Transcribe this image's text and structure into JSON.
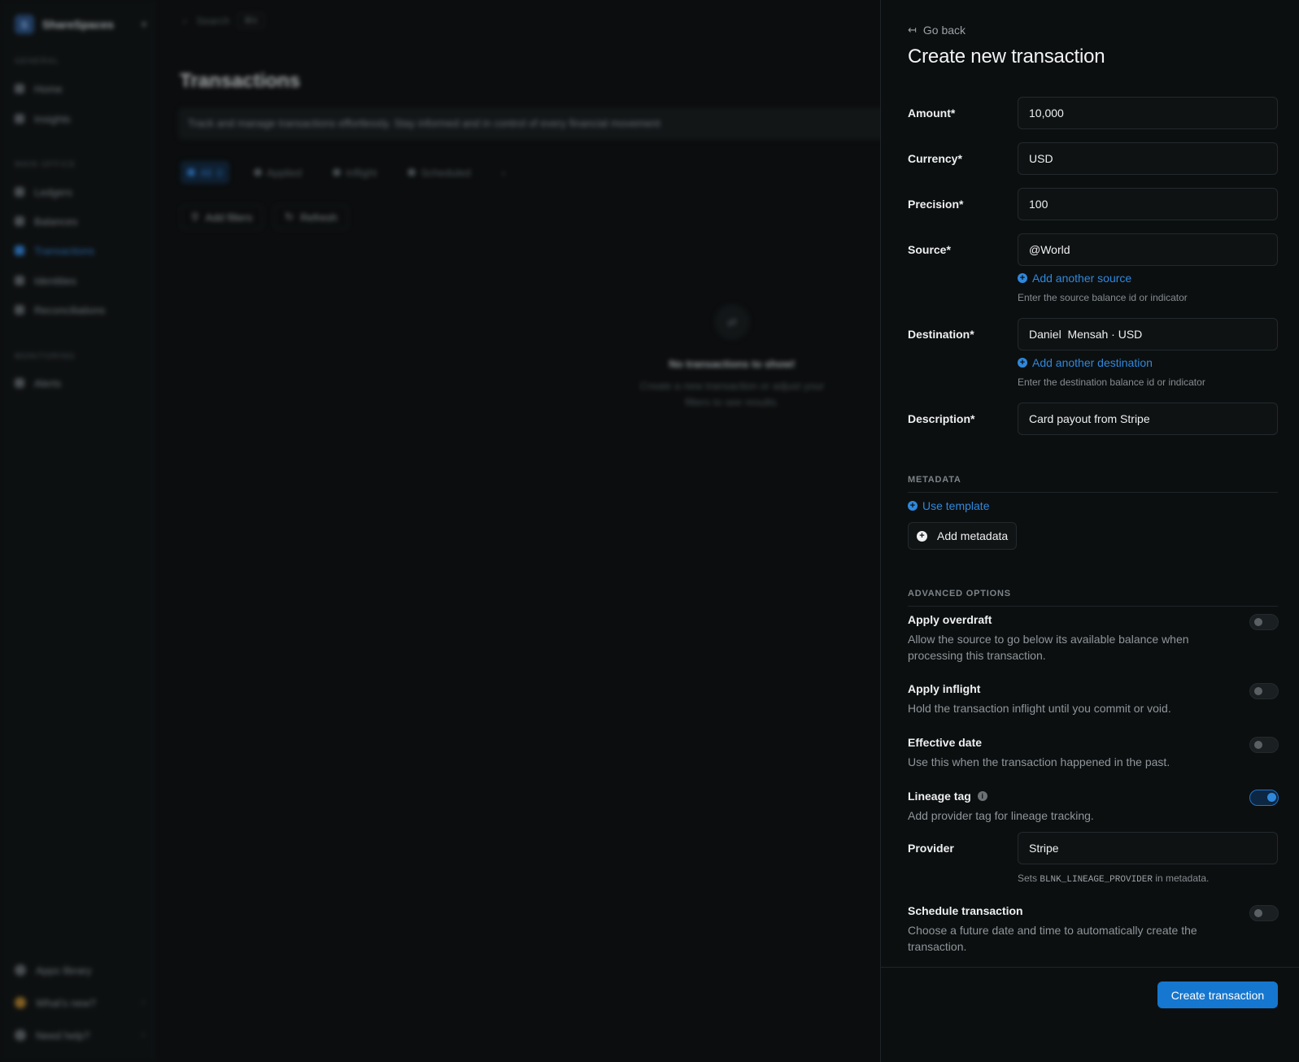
{
  "background": {
    "workspace": {
      "initial": "S",
      "name": "ShareSpaces"
    },
    "sections": [
      "GENERAL",
      "MAIN OFFICE",
      "MONITORING"
    ],
    "nav": [
      {
        "label": "Home"
      },
      {
        "label": "Insights"
      },
      {
        "label": "Ledgers"
      },
      {
        "label": "Balances"
      },
      {
        "label": "Transactions"
      },
      {
        "label": "Identities"
      },
      {
        "label": "Reconciliations"
      },
      {
        "label": "Alerts"
      }
    ],
    "bottom": [
      {
        "label": "Apps library"
      },
      {
        "label": "What's new?"
      },
      {
        "label": "Need help?"
      }
    ],
    "search": {
      "placeholder": "Search",
      "shortcut": "⌘K"
    },
    "page_title": "Transactions",
    "banner": "Track and manage transactions effortlessly. Stay informed and in control of every financial movement",
    "tabs": [
      {
        "label": "All",
        "count": "0"
      },
      {
        "label": "Applied"
      },
      {
        "label": "Inflight"
      },
      {
        "label": "Scheduled"
      }
    ],
    "filters": {
      "add": "Add filters",
      "refresh": "Refresh"
    },
    "empty": {
      "title": "No transactions to show!",
      "desc": "Create a new transaction or adjust your filters to see results."
    }
  },
  "drawer": {
    "go_back": "Go back",
    "title": "Create new transaction",
    "fields": {
      "amount": {
        "label": "Amount*",
        "value": "10,000"
      },
      "currency": {
        "label": "Currency*",
        "value": "USD"
      },
      "precision": {
        "label": "Precision*",
        "value": "100"
      },
      "source": {
        "label": "Source*",
        "value": "@World",
        "add_link": "Add another source",
        "hint": "Enter the source balance id or indicator"
      },
      "destination": {
        "label": "Destination*",
        "value": "Daniel  Mensah · USD",
        "add_link": "Add another destination",
        "hint": "Enter the destination balance id or indicator"
      },
      "description": {
        "label": "Description*",
        "value": "Card payout from Stripe"
      }
    },
    "metadata": {
      "heading": "METADATA",
      "use_template": "Use template",
      "add_metadata": "Add metadata"
    },
    "advanced": {
      "heading": "ADVANCED OPTIONS",
      "overdraft": {
        "title": "Apply overdraft",
        "desc": "Allow the source to go below its available balance when processing this transaction.",
        "enabled": false
      },
      "inflight": {
        "title": "Apply inflight",
        "desc": "Hold the transaction inflight until you commit or void.",
        "enabled": false
      },
      "effective_date": {
        "title": "Effective date",
        "desc": "Use this when the transaction happened in the past.",
        "enabled": false
      },
      "lineage": {
        "title": "Lineage tag",
        "desc": "Add provider tag for lineage tracking.",
        "enabled": true,
        "provider_label": "Provider",
        "provider_value": "Stripe",
        "hint_prefix": "Sets ",
        "hint_code": "BLNK_LINEAGE_PROVIDER",
        "hint_suffix": " in metadata."
      },
      "schedule": {
        "title": "Schedule transaction",
        "desc": "Choose a future date and time to automatically create the transaction.",
        "enabled": false
      }
    },
    "submit": "Create transaction"
  },
  "colors": {
    "accent": "#1577cf",
    "link": "#2f88dc",
    "panel_bg": "#0c0f10"
  }
}
